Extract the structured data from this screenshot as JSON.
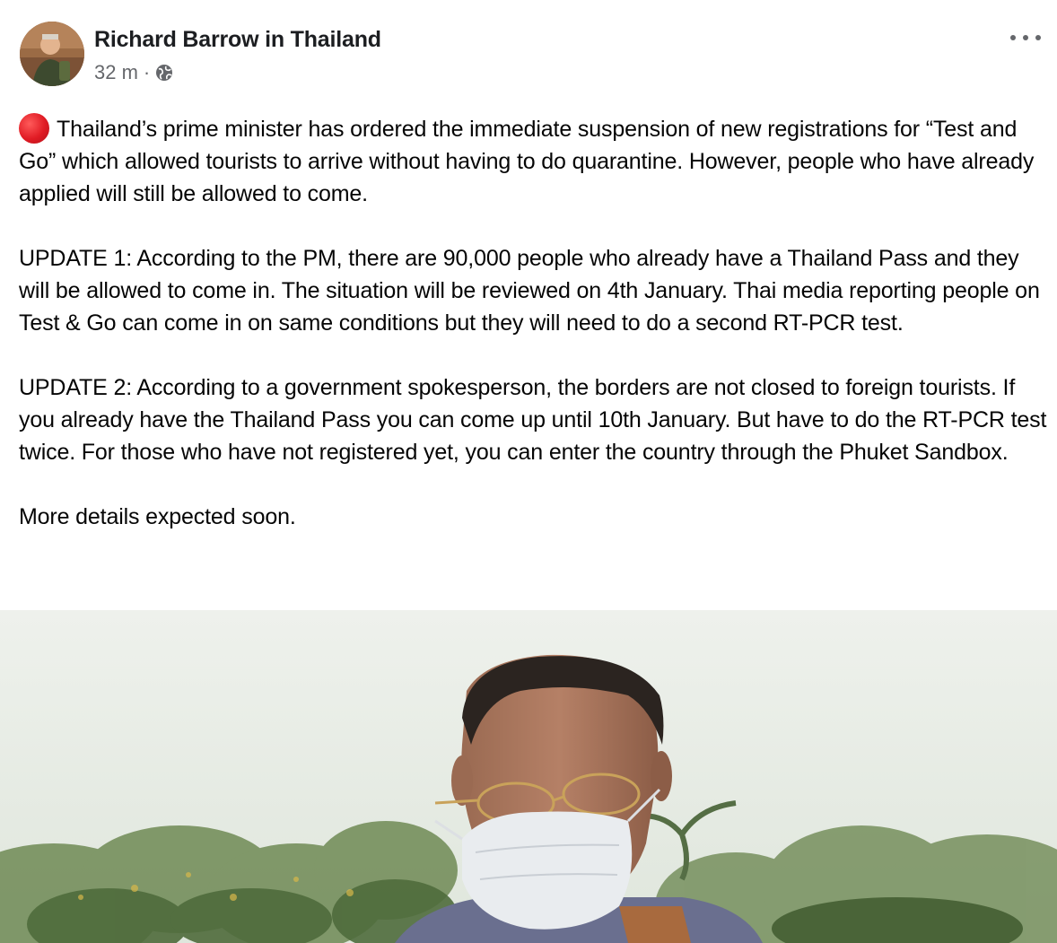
{
  "post": {
    "author": "Richard Barrow in Thailand",
    "time": "32 m",
    "separator": "·",
    "privacy_icon": "globe-icon",
    "more_icon": "more-options-icon",
    "status_emoji": "red-circle",
    "paragraphs": [
      "Thailand’s prime minister has ordered the immediate suspension of new registrations for “Test and Go” which allowed tourists to arrive without having to do quarantine. However, people who have already applied will still be allowed to come.",
      "UPDATE 1: According to the PM, there are 90,000 people who already have a Thailand Pass and they will be allowed to come in. The situation will be reviewed on 4th January. Thai media reporting people on Test & Go can come in on same conditions but they will need to do a second RT-PCR test.",
      "UPDATE 2: According to a government spokesperson, the borders are not closed to foreign tourists. If you already have the Thailand Pass you can come up until 10th January. But have to do the RT-PCR test twice. For those who have not registered yet, you can enter the country through the Phuket Sandbox.",
      "More details expected soon."
    ]
  },
  "colors": {
    "text": "#050505",
    "secondary_text": "#65676b",
    "red_dot": "#e01b24",
    "background": "#ffffff"
  }
}
